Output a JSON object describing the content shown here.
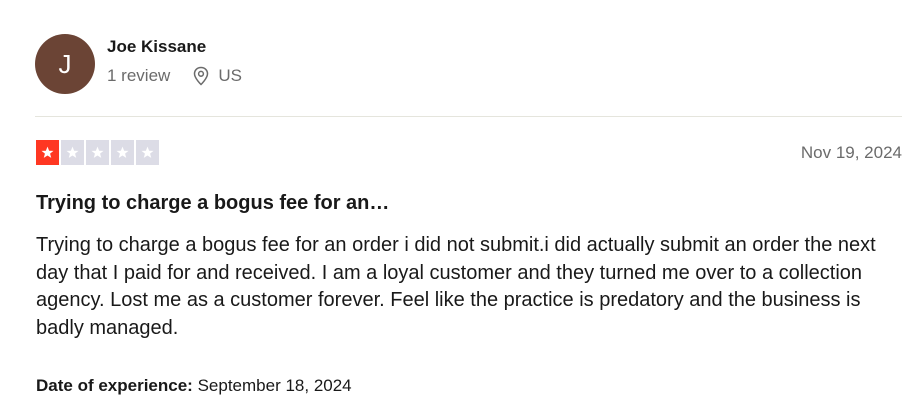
{
  "reviewer": {
    "initial": "J",
    "name": "Joe Kissane",
    "review_count": "1 review",
    "country": "US",
    "avatar_color": "#6b4435"
  },
  "review": {
    "rating": 1,
    "max_rating": 5,
    "date": "Nov 19, 2024",
    "title": "Trying to charge a bogus fee for an…",
    "body": "Trying to charge a bogus fee for an order i did not submit.i did actually submit an order the next day that I paid for and received. I am a loyal customer and they turned me over to a collection agency. Lost me as a customer forever. Feel like the practice is predatory and the business is badly managed.",
    "experience_label": "Date of experience:",
    "experience_date": "September 18, 2024"
  },
  "colors": {
    "star_filled": "#ff3722",
    "star_empty": "#dcdce6"
  },
  "icons": {
    "location": "location-pin-icon",
    "star": "star-icon"
  }
}
